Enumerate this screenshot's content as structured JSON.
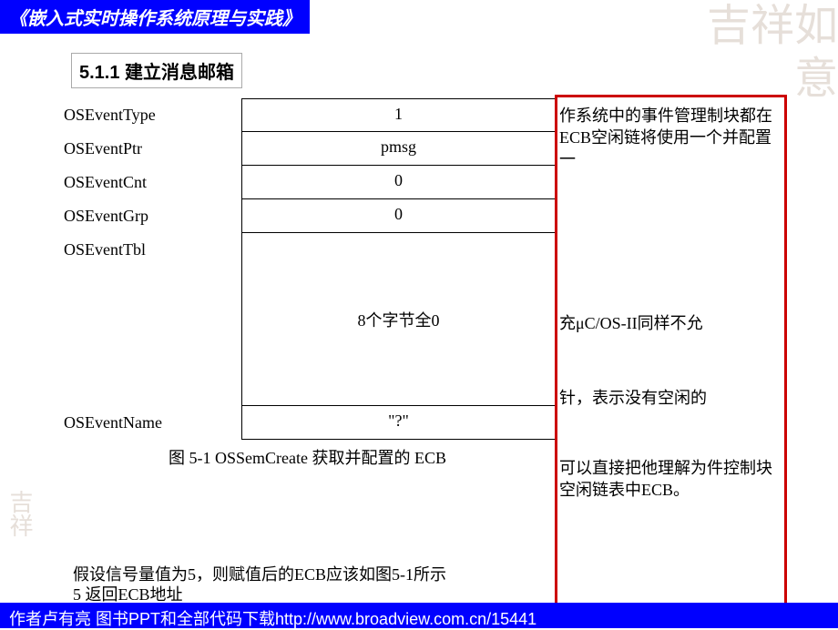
{
  "header": {
    "title": "《嵌入式实时操作系统原理与实践》"
  },
  "section": {
    "title": "5.1.1 建立消息邮箱"
  },
  "diagram": {
    "rows": [
      {
        "label": "OSEventType",
        "value": "1"
      },
      {
        "label": "OSEventPtr",
        "value": "pmsg"
      },
      {
        "label": "OSEventCnt",
        "value": "0"
      },
      {
        "label": "OSEventGrp",
        "value": "0"
      },
      {
        "label": "OSEventTbl",
        "value": "8个字节全0"
      },
      {
        "label": "OSEventName",
        "value": "\"?\""
      }
    ],
    "caption": "图 5-1  OSSemCreate 获取并配置的 ECB"
  },
  "side": {
    "p1": "作系统中的事件管理制块都在ECB空闲链将使用一个并配置一",
    "p2": "充μC/OS-II同样不允",
    "p3": "针，表示没有空闲的",
    "p4": "可以直接把他理解为件控制块空闲链表中ECB。"
  },
  "bottom": {
    "line1": "假设信号量值为5，则赋值后的ECB应该如图5-1所示",
    "line2": "5 返回ECB地址"
  },
  "footer": {
    "text": "作者卢有亮 图书PPT和全部代码下载http://www.broadview.com.cn/15441"
  },
  "watermark": {
    "tr": "吉祥如意",
    "bl": "吉祥"
  }
}
